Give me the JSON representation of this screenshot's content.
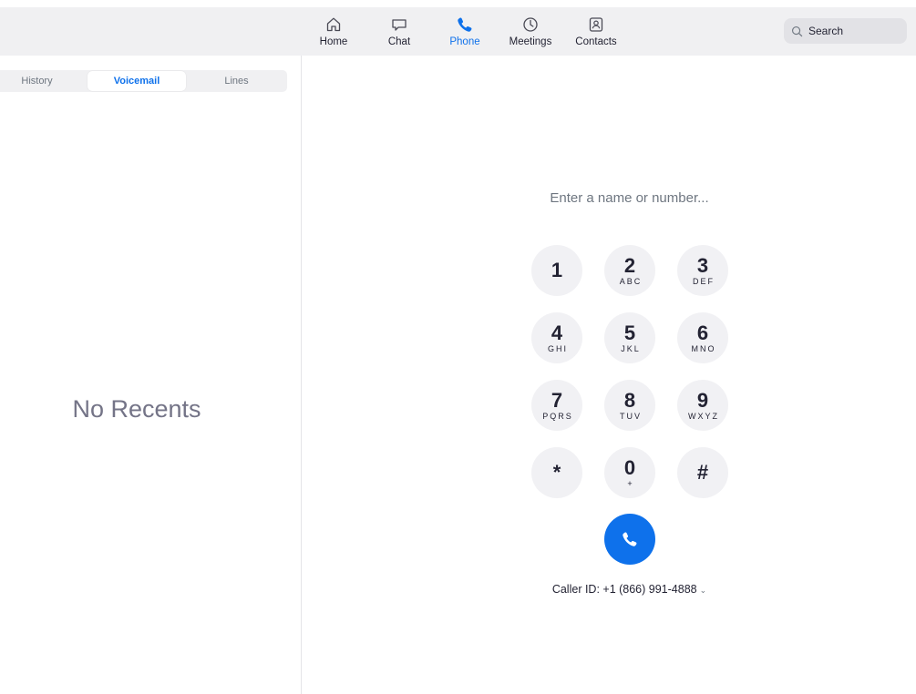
{
  "nav": {
    "items": [
      {
        "label": "Home",
        "icon": "home-icon"
      },
      {
        "label": "Chat",
        "icon": "chat-icon"
      },
      {
        "label": "Phone",
        "icon": "phone-icon",
        "active": true
      },
      {
        "label": "Meetings",
        "icon": "clock-icon"
      },
      {
        "label": "Contacts",
        "icon": "contacts-icon"
      }
    ]
  },
  "search": {
    "placeholder": "Search",
    "icon": "search-icon"
  },
  "left_panel": {
    "tabs": [
      {
        "label": "History"
      },
      {
        "label": "Voicemail",
        "active": true
      },
      {
        "label": "Lines"
      }
    ],
    "empty_message": "No Recents"
  },
  "dialer": {
    "placeholder": "Enter a name or number...",
    "keys": [
      {
        "digit": "1",
        "letters": ""
      },
      {
        "digit": "2",
        "letters": "ABC"
      },
      {
        "digit": "3",
        "letters": "DEF"
      },
      {
        "digit": "4",
        "letters": "GHI"
      },
      {
        "digit": "5",
        "letters": "JKL"
      },
      {
        "digit": "6",
        "letters": "MNO"
      },
      {
        "digit": "7",
        "letters": "PQRS"
      },
      {
        "digit": "8",
        "letters": "TUV"
      },
      {
        "digit": "9",
        "letters": "WXYZ"
      },
      {
        "digit": "*",
        "letters": ""
      },
      {
        "digit": "0",
        "letters": "+"
      },
      {
        "digit": "#",
        "letters": ""
      }
    ],
    "call_icon": "phone-icon",
    "caller_id": "Caller ID: +1 (866) 991-4888",
    "caller_id_chevron": "chevron-down-icon"
  },
  "colors": {
    "accent": "#0e71eb",
    "topbar_bg": "#f0f0f2",
    "key_bg": "#f1f1f4",
    "muted_text": "#747487"
  }
}
